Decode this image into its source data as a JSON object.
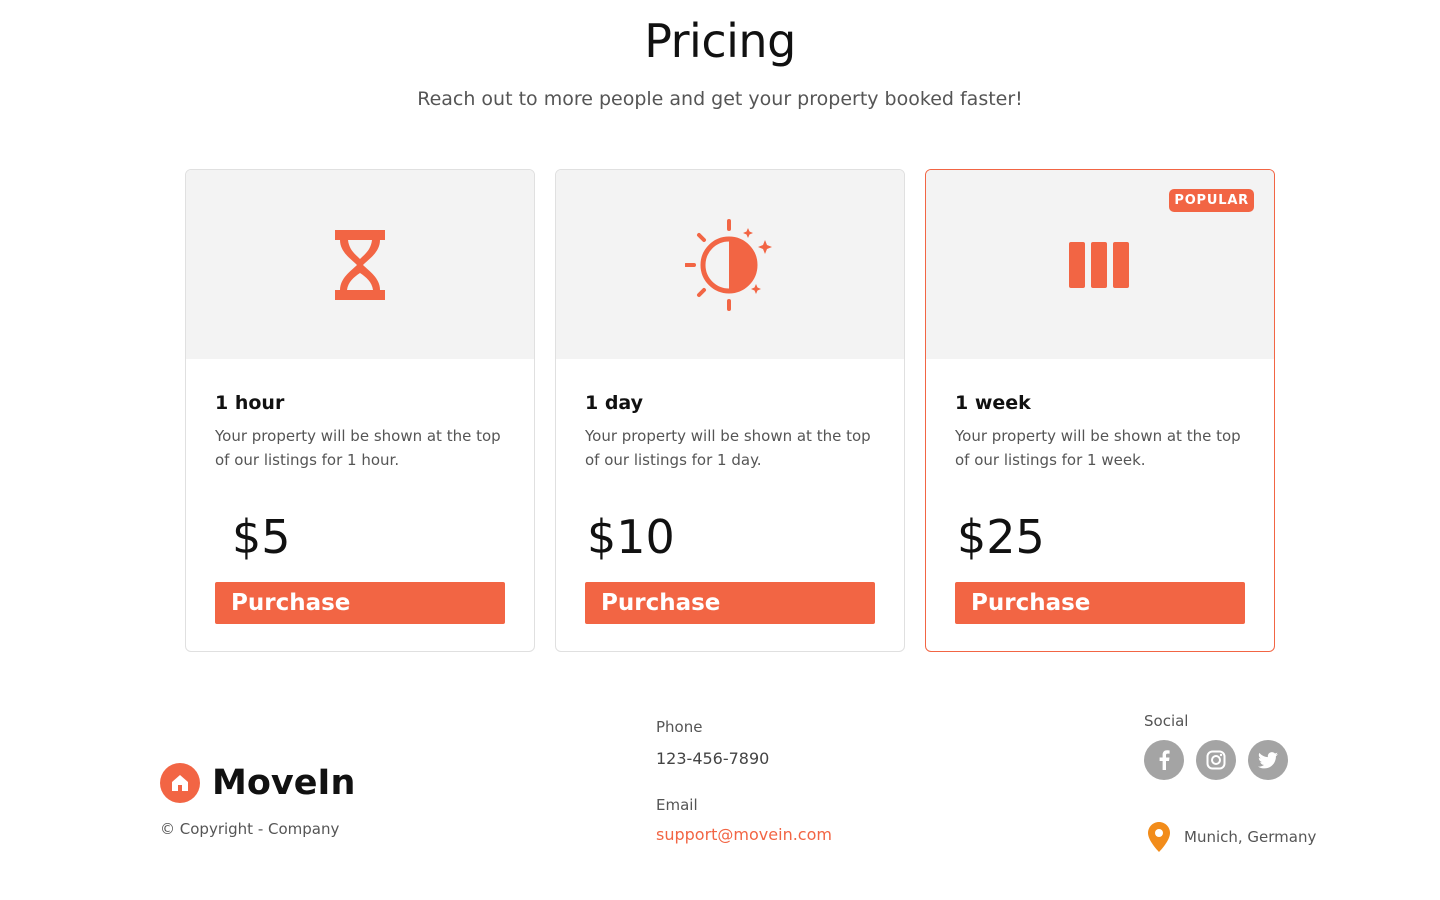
{
  "header": {
    "title": "Pricing",
    "subtitle": "Reach out to more people and get your property booked faster!"
  },
  "plans": [
    {
      "icon": "hourglass-icon",
      "title": "1 hour",
      "description": "Your property will be shown at the top of our listings for 1 hour.",
      "price": "$5",
      "button_label": "Purchase"
    },
    {
      "icon": "sun-icon",
      "title": "1 day",
      "description": "Your property will be shown at the top of our listings for 1 day.",
      "price": "$10",
      "button_label": "Purchase"
    },
    {
      "icon": "week-bars-icon",
      "title": "1 week",
      "description": "Your property will be shown at the top of our listings for 1 week.",
      "price": "$25",
      "button_label": "Purchase",
      "badge": "POPULAR"
    }
  ],
  "footer": {
    "brand": "MoveIn",
    "copyright": "© Copyright - Company",
    "phone_label": "Phone",
    "phone": "123-456-7890",
    "email_label": "Email",
    "email": "support@movein.com",
    "social_label": "Social",
    "social_icons": [
      "facebook-icon",
      "instagram-icon",
      "twitter-icon"
    ],
    "location": "Munich, Germany"
  },
  "colors": {
    "accent": "#f26544",
    "card_hero_bg": "#f3f3f3",
    "social_icon_bg": "#a4a4a4",
    "location_pin": "#f28c1a"
  }
}
